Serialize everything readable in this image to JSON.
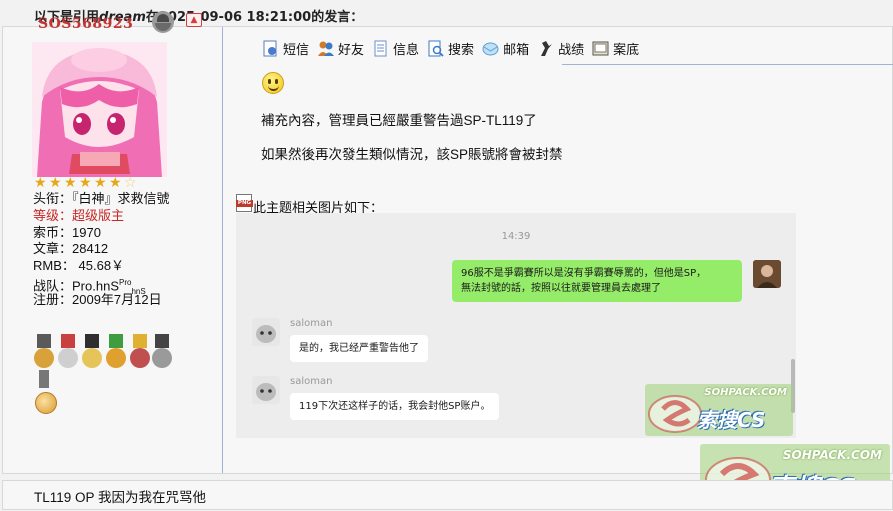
{
  "quote": {
    "prefix": "以下是引用",
    "author": "dream",
    "suffix": "在2025-09-06 18:21:00的发言："
  },
  "user": {
    "name": "SOS568923",
    "stars": 6.5,
    "title_label": "头衔：",
    "title_value": "『白神』求救信號",
    "level_label": "等级：",
    "level_value": "超级版主",
    "coins_label": "索币：",
    "coins_value": "1970",
    "posts_label": "文章：",
    "posts_value": "28412",
    "rmb_label": "RMB：",
    "rmb_value": "45.68￥",
    "team_label": "战队：",
    "team_value": "Pro.hnS",
    "team_sup": "Pro",
    "team_tail": "hnS",
    "reg_label": "注册：",
    "reg_value": "2009年7月12日"
  },
  "toolbar": {
    "items": [
      {
        "label": "短信",
        "icon": "message-icon",
        "color": "#4a7bd0"
      },
      {
        "label": "好友",
        "icon": "friends-icon",
        "color": "#d07a2a"
      },
      {
        "label": "信息",
        "icon": "info-icon",
        "color": "#6b8fc4"
      },
      {
        "label": "搜索",
        "icon": "search-icon",
        "color": "#3a7ac8"
      },
      {
        "label": "邮箱",
        "icon": "mail-icon",
        "color": "#5aa0d8"
      },
      {
        "label": "战绩",
        "icon": "record-icon",
        "color": "#333333"
      },
      {
        "label": "案底",
        "icon": "case-icon",
        "color": "#555555"
      }
    ]
  },
  "post": {
    "line1": "補充內容，管理員已經嚴重警告過SP-TL119了",
    "line2": "如果然後再次發生類似情況，該SP賬號將會被封禁",
    "attachment_label": "此主题相关图片如下："
  },
  "chat": {
    "time": "14:39",
    "outgoing_line1": "96服不是爭霸賽所以是沒有爭霸賽辱罵的，但他是SP，",
    "outgoing_line2": "無法封號的話，按照以往就要管理員去處理了",
    "sender1": "saloman",
    "reply1": "是的，我已经严重警告他了",
    "sender2": "saloman",
    "reply2": "119下次还这样子的话，我会封他SP账户。"
  },
  "watermark": {
    "site": "SOHPACK.COM",
    "brand": "索搜CS"
  },
  "bottom": {
    "text": "TL119 OP 我因为我在咒骂他"
  }
}
